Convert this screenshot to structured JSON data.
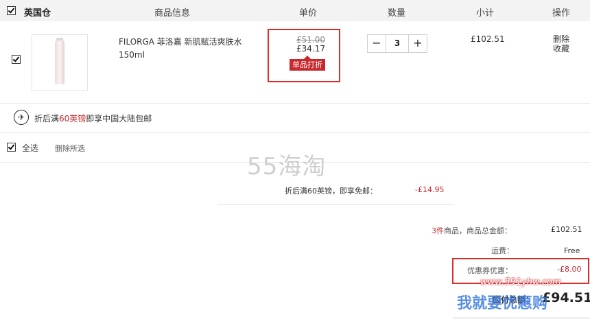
{
  "header": {
    "warehouse": "英国仓",
    "col_info": "商品信息",
    "col_price": "单价",
    "col_qty": "数量",
    "col_subtotal": "小计",
    "col_action": "操作"
  },
  "item": {
    "name_line1": "FILORGA 菲洛嘉 新肌赋活爽肤水",
    "name_line2": "150ml",
    "original_price": "£51.00",
    "price": "£34.17",
    "discount_badge": "单品打折",
    "quantity": "3",
    "qty_minus": "−",
    "qty_plus": "+",
    "subtotal": "£102.51",
    "delete": "删除",
    "favorite": "收藏"
  },
  "shipping_notice": {
    "prefix": "折后满",
    "highlight": "60英镑",
    "suffix": "即享中国大陆包邮"
  },
  "select_bar": {
    "select_all": "全选",
    "delete_selected": "删除所选"
  },
  "watermark": "55海淘",
  "summary": {
    "shipping_discount_label": "折后满60英镑，即享免邮：",
    "shipping_discount_value": "-£14.95",
    "count_prefix": "3件",
    "count_suffix": "商品，商品总金额：",
    "goods_total": "£102.51",
    "freight_label": "运费：",
    "freight_value": "Free",
    "coupon_label": "优惠券优惠：",
    "coupon_value": "-£8.00",
    "payable_label": "应付总额：",
    "payable_value": "£94.51"
  },
  "overlay": {
    "site_url": "www.591yhw.com",
    "site_text": "我就要优惠购"
  },
  "colors": {
    "accent_red": "#c9282d",
    "box_red": "#e02b2b",
    "header_bg": "#f3f3f3"
  }
}
